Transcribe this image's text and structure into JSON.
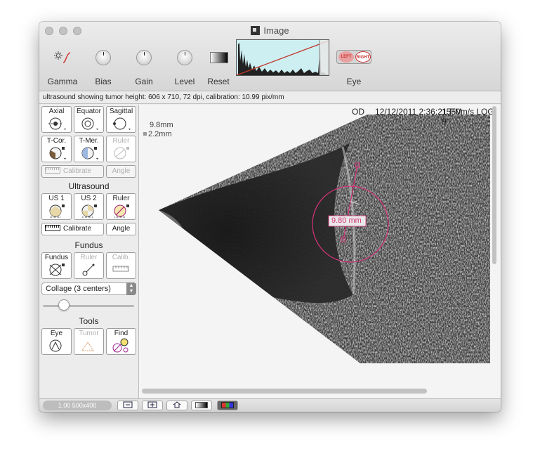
{
  "window": {
    "title": "Image"
  },
  "toolbar": {
    "gamma_label": "Gamma",
    "bias_label": "Bias",
    "gain_label": "Gain",
    "level_label": "Level",
    "reset_label": "Reset",
    "eye_label": "Eye",
    "eye_left": "LEFT",
    "eye_right": "RIGHT"
  },
  "info_bar": "ultrasound showing tumor height: 606 x 710, 72 dpi, calibration: 10.99 pix/mm",
  "sidebar": {
    "view_buttons": [
      "Axial",
      "Equator",
      "Sagittal",
      "T-Cor.",
      "T-Mer.",
      "Ruler"
    ],
    "calibrate_label": "Calibrate",
    "angle_label": "Angle",
    "ultrasound_header": "Ultrasound",
    "ultrasound_buttons": [
      "US 1",
      "US 2",
      "Ruler"
    ],
    "fundus_header": "Fundus",
    "fundus_buttons": [
      "Fundus",
      "Ruler",
      "Calib."
    ],
    "collage_select": "Collage (3 centers)",
    "tools_header": "Tools",
    "tools_buttons": [
      "Eye",
      "Tumor",
      "Find"
    ]
  },
  "viewer": {
    "eye_code": "OD",
    "datetime": "12/12/2011  2:36:21 PM",
    "probe_info": "1550m/s LOG 9",
    "legend_value_1": "9.8mm",
    "legend_value_2": "2.2mm",
    "measurement_label": "9.80 mm",
    "accent_color": "#d6337a"
  },
  "bottom_bar": {
    "zoom_text": "1.00 500x400"
  }
}
